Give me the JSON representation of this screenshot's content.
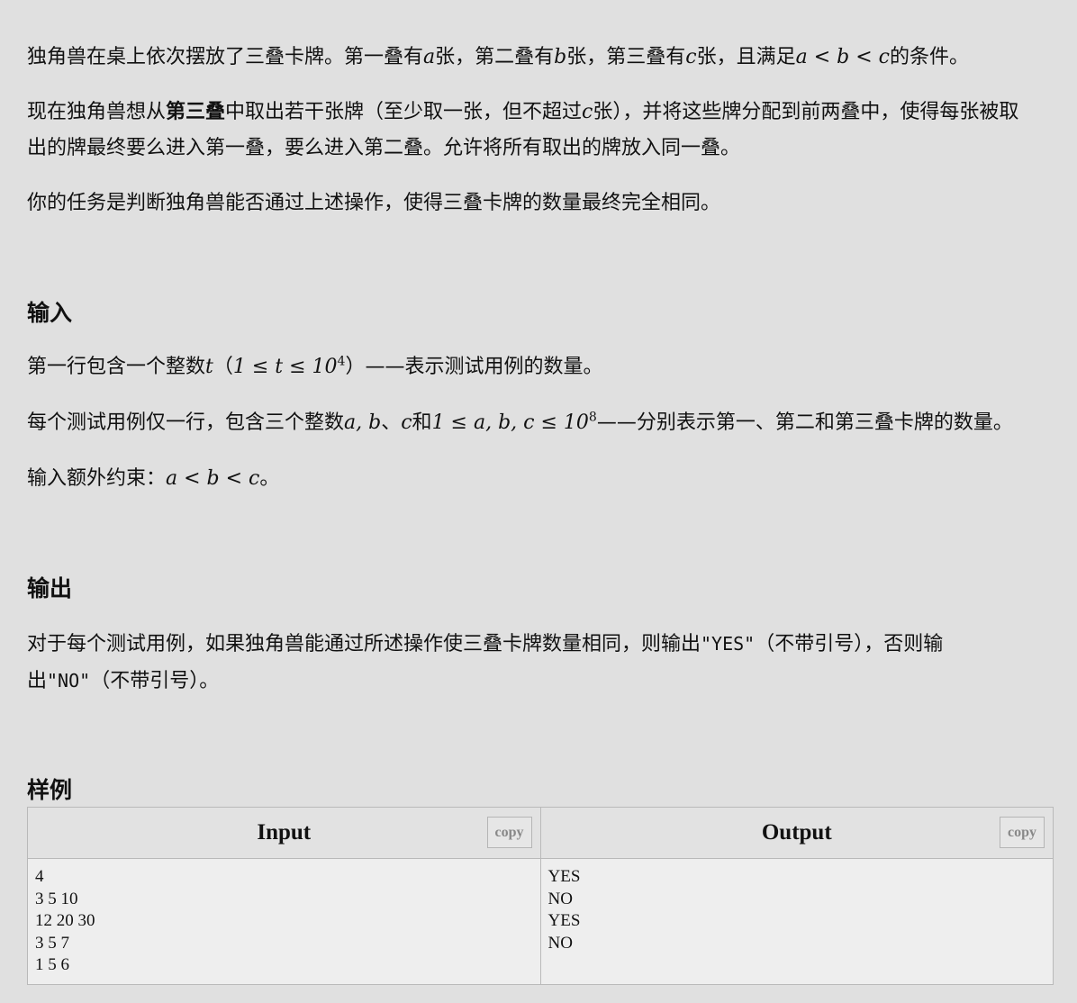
{
  "statement": {
    "p1": {
      "t1": "独角兽在桌上依次摆放了三叠卡牌。第一叠有",
      "a": "a",
      "t2": "张，第二叠有",
      "b": "b",
      "t3": "张，第三叠有",
      "c": "c",
      "t4": "张，且满足",
      "cond": "a < b < c",
      "t5": "的条件。"
    },
    "p2": {
      "t1": "现在独角兽想从",
      "bold": "第三叠",
      "t2": "中取出若干张牌（至少取一张，但不超过",
      "c": "c",
      "t3": "张），并将这些牌分配到前两叠中，使得每张被取",
      "line2": "出的牌最终要么进入第一叠，要么进入第二叠。允许将所有取出的牌放入同一叠。"
    },
    "p3": "你的任务是判断独角兽能否通过上述操作，使得三叠卡牌的数量最终完全相同。"
  },
  "input_section": {
    "heading": "输入",
    "p1": {
      "t1": "第一行包含一个整数",
      "t": "t",
      "open": "（",
      "range_pre": "1 ≤ t ≤ 10",
      "range_exp": "4",
      "close": "）",
      "dash": "——",
      "t2": "表示测试用例的数量。"
    },
    "p2": {
      "t1": "每个测试用例仅一行，包含三个整数",
      "vars_ab": "a, b",
      "sep": "、",
      "var_c": "c",
      "and": "和",
      "range_pre": "1 ≤ a, b, c ≤ 10",
      "range_exp": "8",
      "dash": "——",
      "t2": "分别表示第一、第二和第三叠卡牌的数量。"
    },
    "p3": {
      "t1": "输入额外约束：",
      "cond": "a < b < c",
      "end": "。"
    }
  },
  "output_section": {
    "heading": "输出",
    "t1": "对于每个测试用例，如果独角兽能通过所述操作使三叠卡牌数量相同，则输出",
    "yes": "\"YES\"",
    "t2": "（不带引号），否则输",
    "t3": "出",
    "no": "\"NO\"",
    "t4": "（不带引号）。"
  },
  "samples": {
    "heading": "样例",
    "input_title": "Input",
    "output_title": "Output",
    "copy_label": "copy",
    "input_lines": [
      "4",
      "3 5 10",
      "12 20 30",
      "3 5 7",
      "1 5 6"
    ],
    "output_lines": [
      "YES",
      "NO",
      "YES",
      "NO"
    ]
  }
}
